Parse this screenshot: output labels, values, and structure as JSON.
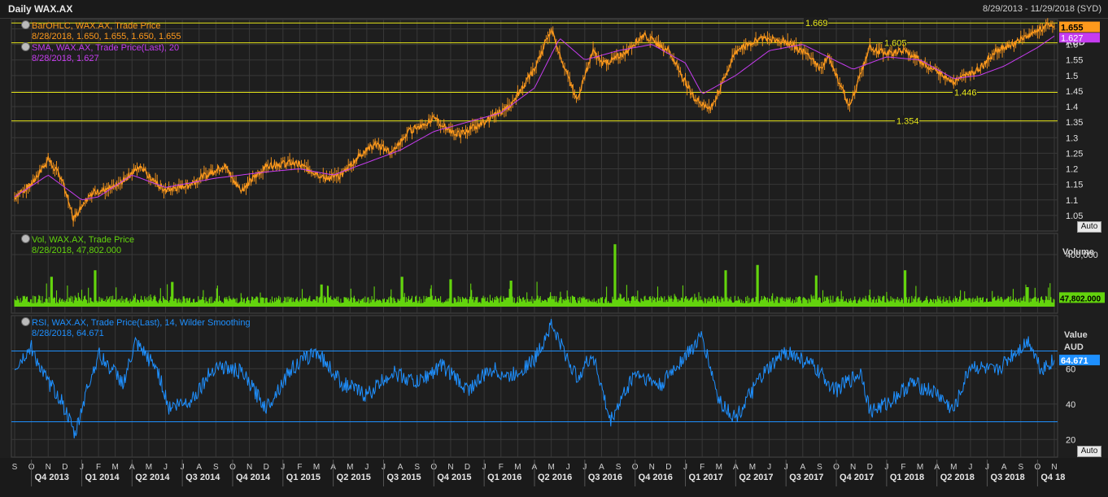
{
  "header": {
    "title": "Daily WAX.AX",
    "range": "8/29/2013 - 11/29/2018 (SYD)"
  },
  "colors": {
    "price": "#ff9a1c",
    "sma": "#c63cf0",
    "volume": "#63d40d",
    "rsi": "#1e90ff",
    "hline": "#e6e619",
    "grid": "#383838",
    "background": "#1e1e1e"
  },
  "legends": {
    "price_line1": "BarOHLC, WAX.AX, Trade Price",
    "price_line2": "8/28/2018, 1.650, 1.655, 1.650, 1.655",
    "sma_line1": "SMA, WAX.AX, Trade Price(Last), 20",
    "sma_line2": "8/28/2018, 1.627",
    "vol_line1": "Vol, WAX.AX, Trade Price",
    "vol_line2": "8/28/2018, 47,802.000",
    "rsi_line1": "RSI, WAX.AX, Trade Price(Last), 14, Wilder Smoothing",
    "rsi_line2": "8/28/2018, 64.671"
  },
  "auto_label": "Auto",
  "chart_data": [
    {
      "type": "line",
      "panel": "price",
      "series": [
        {
          "name": "BarOHLC, WAX.AX, Trade Price",
          "x": [
            0,
            1,
            2,
            2.8,
            3.5,
            4.5,
            6,
            7.5,
            8.3,
            9,
            10.5,
            11,
            12.5,
            13.5,
            15,
            16.5,
            17.5,
            18.5,
            19.5,
            20.5,
            21.5,
            22.5,
            23.5,
            25,
            25.8,
            26.5,
            28,
            29.5,
            31,
            32,
            33.5,
            34.5,
            35,
            35.7,
            36.5,
            37.5,
            39,
            40.5,
            41.5,
            42,
            43,
            44.5,
            46,
            47.5,
            48,
            48.6,
            49,
            49.8,
            51,
            52,
            53,
            54.5,
            56,
            57.5,
            58.5,
            59.5,
            60.5,
            61.5,
            62
          ],
          "values": [
            1.11,
            1.15,
            1.23,
            1.17,
            1.04,
            1.12,
            1.14,
            1.21,
            1.16,
            1.13,
            1.15,
            1.17,
            1.21,
            1.13,
            1.21,
            1.22,
            1.2,
            1.17,
            1.18,
            1.24,
            1.28,
            1.25,
            1.32,
            1.36,
            1.33,
            1.31,
            1.35,
            1.4,
            1.52,
            1.65,
            1.42,
            1.58,
            1.54,
            1.55,
            1.58,
            1.63,
            1.58,
            1.43,
            1.39,
            1.45,
            1.58,
            1.62,
            1.61,
            1.56,
            1.52,
            1.56,
            1.5,
            1.4,
            1.59,
            1.57,
            1.58,
            1.53,
            1.48,
            1.52,
            1.58,
            1.6,
            1.63,
            1.66,
            1.655
          ]
        },
        {
          "name": "SMA, WAX.AX, Trade Price(Last), 20",
          "x": [
            0,
            2,
            4,
            5,
            7,
            9,
            12,
            15,
            17,
            19,
            21,
            23,
            25,
            27,
            29,
            31,
            32.5,
            34,
            36,
            38,
            40,
            41,
            43,
            45,
            47,
            48.5,
            50,
            52,
            54,
            56,
            57.5,
            59,
            61,
            62
          ],
          "values": [
            1.11,
            1.18,
            1.1,
            1.11,
            1.18,
            1.14,
            1.17,
            1.19,
            1.2,
            1.18,
            1.22,
            1.26,
            1.32,
            1.35,
            1.38,
            1.46,
            1.62,
            1.55,
            1.58,
            1.6,
            1.54,
            1.44,
            1.5,
            1.58,
            1.6,
            1.56,
            1.52,
            1.56,
            1.55,
            1.49,
            1.5,
            1.53,
            1.59,
            1.627
          ]
        }
      ],
      "yticks": [
        1.05,
        1.1,
        1.15,
        1.2,
        1.25,
        1.3,
        1.35,
        1.4,
        1.45,
        1.5,
        1.55,
        1.6,
        1.65
      ],
      "ylim": [
        1.0,
        1.68
      ],
      "ylabel": "AUD",
      "hlines": [
        1.669,
        1.605,
        1.446,
        1.354
      ],
      "last_price": 1.655,
      "last_sma": 1.627
    },
    {
      "type": "bar",
      "panel": "volume",
      "series": [
        {
          "name": "Vol, WAX.AX, Trade Price",
          "x": [
            2.2,
            4.8,
            9.4,
            18.3,
            23.1,
            26,
            29.6,
            35.8,
            42.4,
            44.3,
            47.8,
            53.1,
            60.4
          ],
          "values": [
            230000,
            280000,
            190000,
            170000,
            230000,
            210000,
            200000,
            480000,
            280000,
            320000,
            240000,
            280000,
            150000
          ]
        }
      ],
      "yticks": [
        400000
      ],
      "ylabel": "Volume",
      "last_value": 47802
    },
    {
      "type": "line",
      "panel": "rsi",
      "series": [
        {
          "name": "RSI, WAX.AX, Trade Price(Last), 14, Wilder Smoothing",
          "x": [
            0,
            1,
            1.8,
            2.8,
            3.6,
            4.2,
            5,
            6.5,
            7.2,
            8.5,
            9.2,
            10.5,
            12,
            13.5,
            15,
            16.5,
            18,
            19.5,
            21,
            22.5,
            24,
            25.5,
            27,
            28.5,
            29.5,
            31,
            32,
            33.5,
            34.5,
            35.5,
            37,
            38.5,
            39.5,
            41,
            42,
            43,
            44.5,
            46,
            47.5,
            49,
            50.5,
            51,
            52,
            53.5,
            55,
            56,
            57,
            58.5,
            59.5,
            60.5,
            61.2,
            62
          ],
          "values": [
            60,
            72,
            55,
            42,
            22,
            45,
            68,
            52,
            74,
            60,
            38,
            42,
            62,
            58,
            38,
            60,
            70,
            52,
            45,
            58,
            52,
            62,
            48,
            60,
            55,
            65,
            85,
            55,
            68,
            30,
            58,
            50,
            62,
            78,
            42,
            32,
            55,
            70,
            62,
            48,
            58,
            36,
            40,
            52,
            46,
            36,
            62,
            58,
            68,
            76,
            60,
            64.671
          ]
        }
      ],
      "yticks": [
        20,
        40,
        60
      ],
      "ylim": [
        10,
        90
      ],
      "ylabels": [
        "Value",
        "AUD"
      ],
      "hlines": [
        70,
        30
      ],
      "last_value": 64.671
    }
  ],
  "x_axis": {
    "months": [
      "S",
      "O",
      "N",
      "D",
      "J",
      "F",
      "M",
      "A",
      "M",
      "J",
      "J",
      "A",
      "S",
      "O",
      "N",
      "D",
      "J",
      "F",
      "M",
      "A",
      "M",
      "J",
      "J",
      "A",
      "S",
      "O",
      "N",
      "D",
      "J",
      "F",
      "M",
      "A",
      "M",
      "J",
      "J",
      "A",
      "S",
      "O",
      "N",
      "D",
      "J",
      "F",
      "M",
      "A",
      "M",
      "J",
      "J",
      "A",
      "S",
      "O",
      "N",
      "D",
      "J",
      "F",
      "M",
      "A",
      "M",
      "J",
      "J",
      "A",
      "S",
      "O",
      "N"
    ],
    "quarters": [
      "Q4 2013",
      "Q1 2014",
      "Q2 2014",
      "Q3 2014",
      "Q4 2014",
      "Q1 2015",
      "Q2 2015",
      "Q3 2015",
      "Q4 2015",
      "Q1 2016",
      "Q2 2016",
      "Q3 2016",
      "Q4 2016",
      "Q1 2017",
      "Q2 2017",
      "Q3 2017",
      "Q4 2017",
      "Q1 2018",
      "Q2 2018",
      "Q3 2018",
      "Q4 18"
    ]
  }
}
